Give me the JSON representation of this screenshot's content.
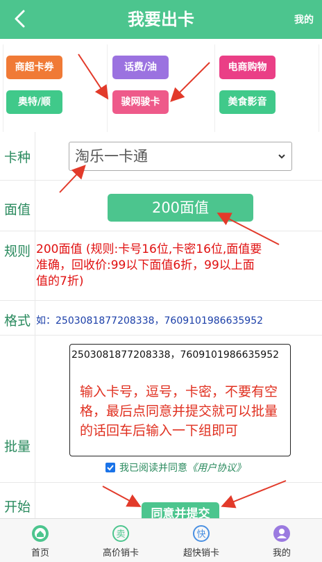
{
  "header": {
    "title": "我要出卡",
    "mine": "我的"
  },
  "categories": {
    "col1": [
      "商超卡券",
      "奥特/顺旺"
    ],
    "col2": [
      "话费/油卡",
      "骏网骏卡"
    ],
    "col3": [
      "电商购物",
      "美食影音"
    ]
  },
  "colors": {
    "brand": "#4cc58e",
    "tag_orange": "#f07a36",
    "tag_purple": "#9b72e0",
    "tag_pink": "#ea3f86",
    "tag_green": "#40c98a",
    "tag_rose": "#ee5a8a",
    "arrow_red": "#e23a2a"
  },
  "form": {
    "card_type_label": "卡种",
    "card_type_value": "淘乐一卡通",
    "face_label": "面值",
    "face_value": "200面值",
    "rule_label": "规则",
    "rule_text": "200面值 (规则:卡号16位,卡密16位,面值要准确，回收价:99以下面值6折，99以上面值的7折)",
    "format_label": "格式",
    "format_text": "如：2503081877208338，7609101986635952",
    "batch_label": "批量",
    "batch_value": "2503081877208338，7609101986635952",
    "batch_placeholder": "输入卡号，逗号，卡密，不要有空格，最后点同意并提交就可以批量的话回车后输入一下组即可",
    "agree_prefix": "我已阅读并同意",
    "agree_link": "《用户协议》",
    "start_label": "开始",
    "submit": "同意并提交"
  },
  "tabbar": [
    {
      "label": "首页",
      "icon": "home-icon"
    },
    {
      "label": "高价销卡",
      "icon": "sell-icon"
    },
    {
      "label": "超快销卡",
      "icon": "fast-icon"
    },
    {
      "label": "我的",
      "icon": "user-icon"
    }
  ]
}
